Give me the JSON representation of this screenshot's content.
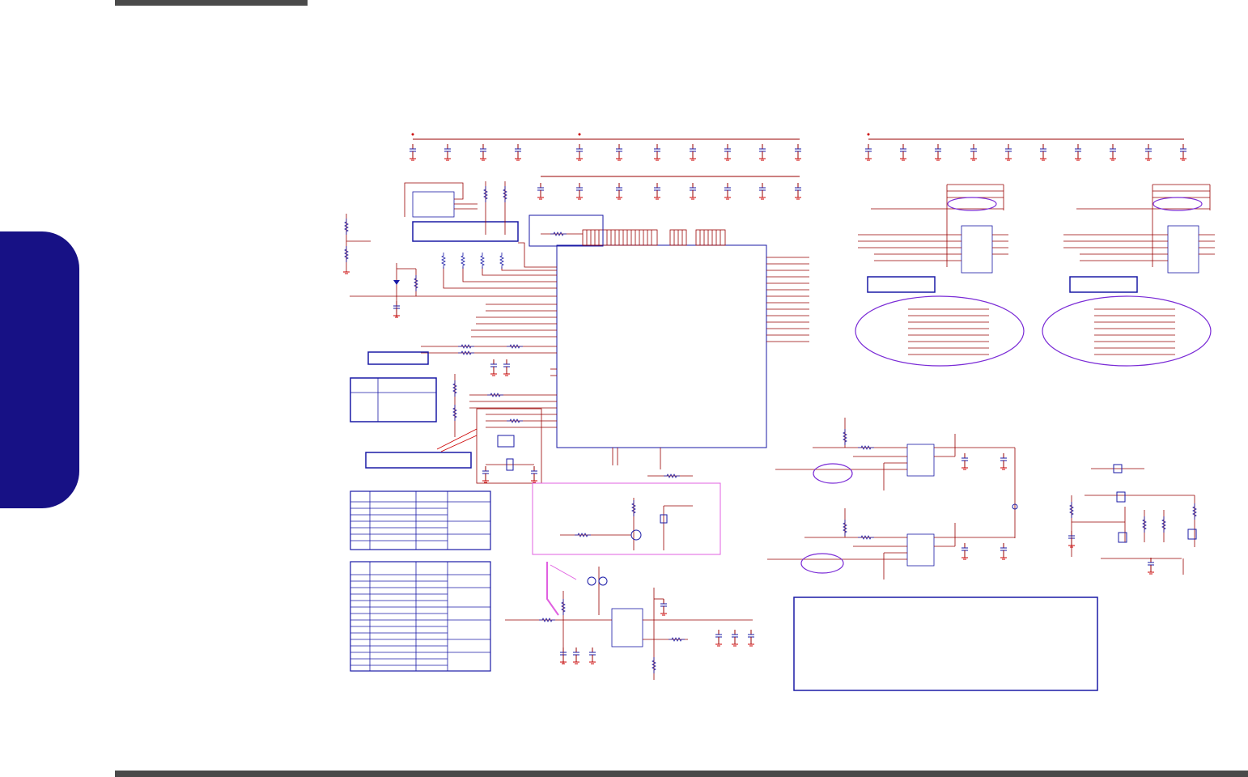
{
  "colors": {
    "tab": "#171185",
    "wire": "#990000",
    "component": "#1a1aa6",
    "highlight": "#7a2bd6",
    "callout": "#e060e0",
    "bar": "#4a4a4a"
  },
  "icons": [
    "ground-symbol",
    "resistor",
    "capacitor",
    "crystal",
    "transistor",
    "diode"
  ]
}
